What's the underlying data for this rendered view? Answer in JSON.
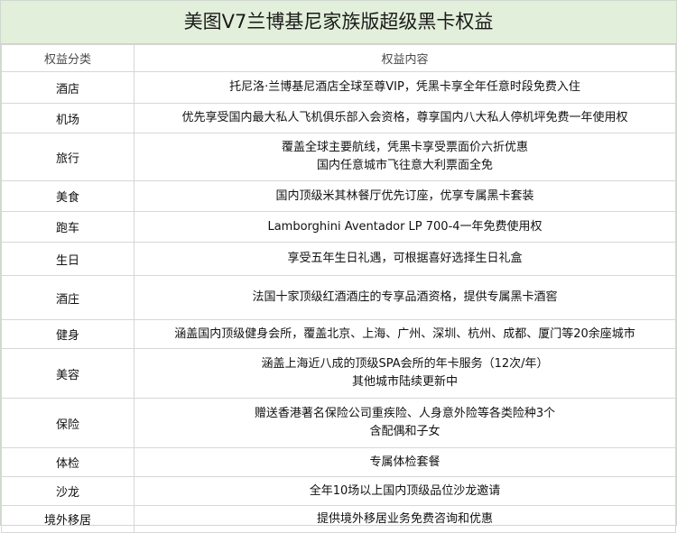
{
  "title": "美图V7兰博基尼家族版超级黑卡权益",
  "header": {
    "category": "权益分类",
    "content": "权益内容"
  },
  "rows": [
    {
      "category": "酒店",
      "lines": [
        "托尼洛·兰博基尼酒店全球至尊VIP，凭黑卡享全年任意时段免费入住"
      ]
    },
    {
      "category": "机场",
      "lines": [
        "优先享受国内最大私人飞机俱乐部入会资格，尊享国内八大私人停机坪免费一年使用权"
      ]
    },
    {
      "category": "旅行",
      "lines": [
        "覆盖全球主要航线，凭黑卡享受票面价六折优惠",
        "国内任意城市飞往意大利票面全免"
      ]
    },
    {
      "category": "美食",
      "lines": [
        "国内顶级米其林餐厅优先订座，优享专属黑卡套装"
      ]
    },
    {
      "category": "跑车",
      "lines": [
        "Lamborghini Aventador LP 700-4一年免费使用权"
      ]
    },
    {
      "category": "生日",
      "lines": [
        "享受五年生日礼遇，可根据喜好选择生日礼盒"
      ]
    },
    {
      "category": "酒庄",
      "lines": [
        "法国十家顶级红酒酒庄的专享品酒资格，提供专属黑卡酒窖"
      ]
    },
    {
      "category": "健身",
      "lines": [
        "涵盖国内顶级健身会所，覆盖北京、上海、广州、深圳、杭州、成都、厦门等20余座城市"
      ]
    },
    {
      "category": "美容",
      "lines": [
        "涵盖上海近八成的顶级SPA会所的年卡服务（12次/年）",
        "其他城市陆续更新中"
      ]
    },
    {
      "category": "保险",
      "lines": [
        "赠送香港著名保险公司重疾险、人身意外险等各类险种3个",
        "含配偶和子女"
      ]
    },
    {
      "category": "体检",
      "lines": [
        "专属体检套餐"
      ]
    },
    {
      "category": "沙龙",
      "lines": [
        "全年10场以上国内顶级品位沙龙邀请"
      ]
    },
    {
      "category": "境外移居",
      "lines": [
        "提供境外移居业务免费咨询和优惠"
      ]
    }
  ]
}
